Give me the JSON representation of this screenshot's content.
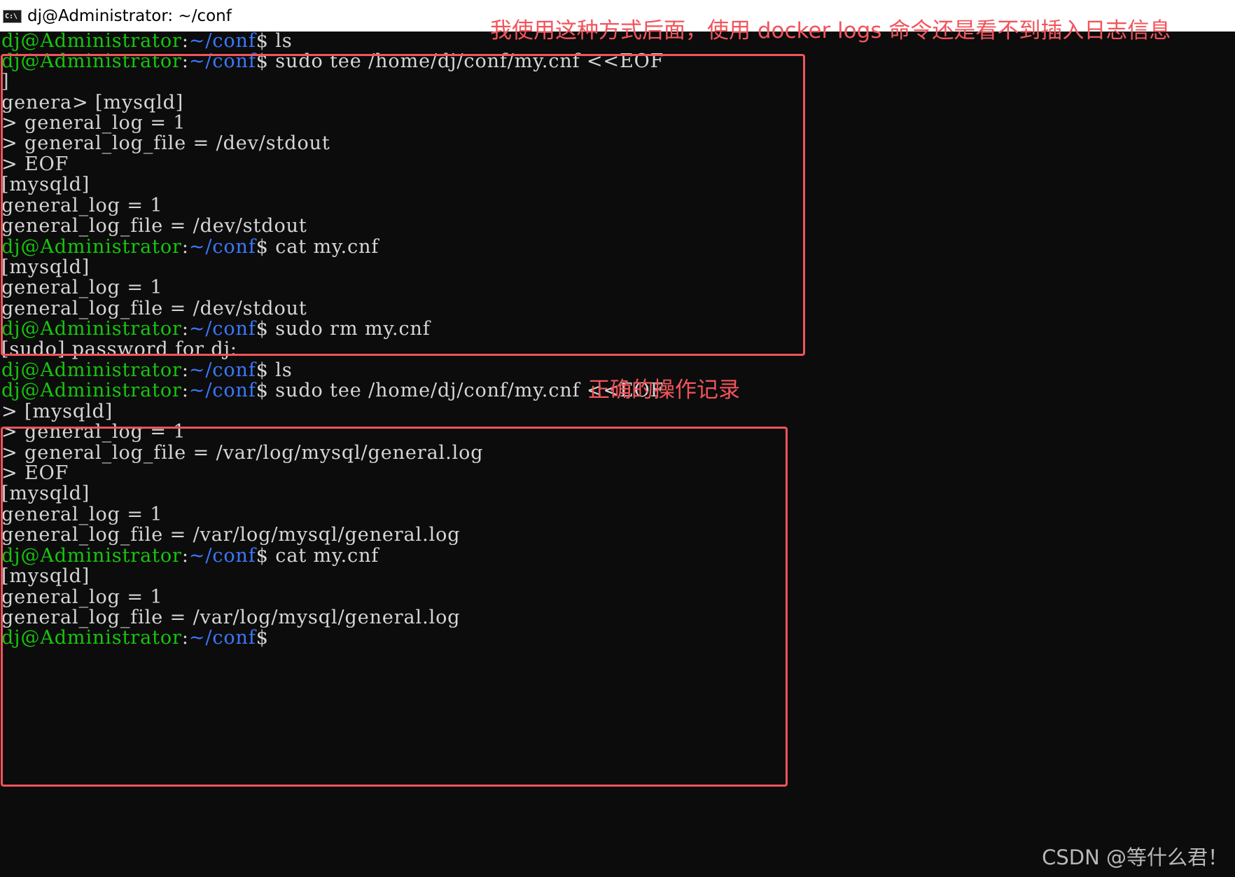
{
  "window": {
    "title": "dj@Administrator: ~/conf",
    "icon": "C:\\"
  },
  "prompt": {
    "user": "dj@Administrator",
    "sep": ":",
    "path": "~/conf",
    "symbol": "$"
  },
  "commands": {
    "ls": " ls",
    "tee": " sudo tee /home/dj/conf/my.cnf <<EOF",
    "cat": " cat my.cnf",
    "rm": " sudo rm my.cnf"
  },
  "output": {
    "cursor": "]",
    "genera_section": "genera> [mysqld]",
    "cont_general_log": "> general_log = 1",
    "cont_log_file_stdout": "> general_log_file = /dev/stdout",
    "cont_eof": "> EOF",
    "section": "[mysqld]",
    "general_log": "general_log = 1",
    "log_file_stdout": "general_log_file = /dev/stdout",
    "sudo_password": "[sudo] password for dj:",
    "cont_section": "> [mysqld]",
    "cont_log_file_var": "> general_log_file = /var/log/mysql/general.log",
    "log_file_var": "general_log_file = /var/log/mysql/general.log"
  },
  "annotations": {
    "top_note": "我使用这种方式后面，使用 docker logs 命令还是看不到插入日志信息",
    "bottom_note": "正确的操作记录",
    "color": "#f2545b"
  },
  "watermark": "CSDN @等什么君！",
  "colors": {
    "background": "#0c0c0c",
    "text": "#d6d6d6",
    "user": "#16c60c",
    "path": "#3b78ff"
  }
}
